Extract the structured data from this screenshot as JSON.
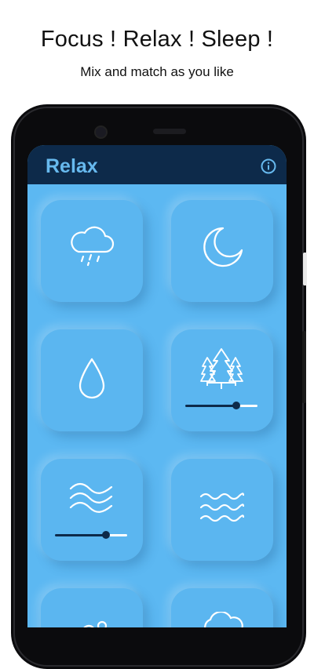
{
  "promo": {
    "headline": "Focus ! Relax ! Sleep !",
    "subline": "Mix and match as you like"
  },
  "app": {
    "title": "Relax",
    "info_icon": "info-circle-icon",
    "colors": {
      "app_bar": "#0d2a4a",
      "title": "#67b9ee",
      "background": "#5cb8f2",
      "slider_active": "#0d2a4a",
      "slider_inactive": "#ffffff"
    }
  },
  "sounds": [
    {
      "id": "rain",
      "icon": "rain-cloud-icon",
      "active": false
    },
    {
      "id": "night",
      "icon": "moon-icon",
      "active": false
    },
    {
      "id": "water-drop",
      "icon": "water-drop-icon",
      "active": false
    },
    {
      "id": "forest",
      "icon": "pine-trees-icon",
      "active": true,
      "volume": 0.7
    },
    {
      "id": "wind",
      "icon": "wind-icon",
      "active": true,
      "volume": 0.7
    },
    {
      "id": "waves",
      "icon": "waves-icon",
      "active": false
    },
    {
      "id": "unknown-bottom-left",
      "icon": "partial-icon",
      "active": false
    },
    {
      "id": "cloud",
      "icon": "cloud-icon",
      "active": false
    }
  ]
}
